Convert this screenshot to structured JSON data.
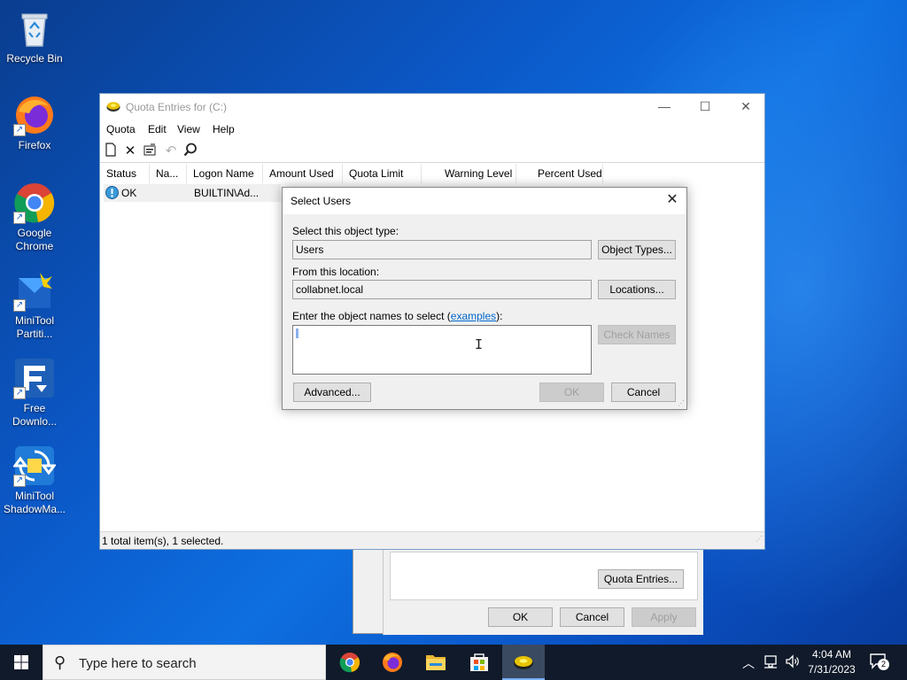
{
  "desktop": {
    "icons": [
      {
        "label": "Recycle Bin"
      },
      {
        "label": "Firefox"
      },
      {
        "label": "Google Chrome"
      },
      {
        "label": "MiniTool Partiti..."
      },
      {
        "label": "Free Downlo..."
      },
      {
        "label": "MiniTool ShadowMa..."
      }
    ]
  },
  "quota_window": {
    "title": "Quota Entries for  (C:)",
    "menu": [
      "Quota",
      "Edit",
      "View",
      "Help"
    ],
    "columns": [
      "Status",
      "Na...",
      "Logon Name",
      "Amount Used",
      "Quota Limit",
      "Warning Level",
      "Percent Used"
    ],
    "rows": [
      {
        "status": "OK",
        "name": "",
        "logon": "BUILTIN\\Ad..."
      }
    ],
    "status_bar": "1 total item(s), 1 selected."
  },
  "select_users": {
    "title": "Select Users",
    "object_type_label": "Select this object type:",
    "object_type_value": "Users",
    "object_types_button": "Object Types...",
    "location_label": "From this location:",
    "location_value": "collabnet.local",
    "locations_button": "Locations...",
    "names_label_pre": "Enter the object names to select (",
    "names_label_link": "examples",
    "names_label_post": "):",
    "check_names_button": "Check Names",
    "advanced_button": "Advanced...",
    "ok_button": "OK",
    "cancel_button": "Cancel"
  },
  "properties_dialog": {
    "quota_entries_button": "Quota Entries...",
    "ok_button": "OK",
    "cancel_button": "Cancel",
    "apply_button": "Apply"
  },
  "taskbar": {
    "search_placeholder": "Type here to search",
    "time": "4:04 AM",
    "date": "7/31/2023",
    "notification_count": "2",
    "apps": [
      "chrome-icon",
      "firefox-icon",
      "file-explorer-icon",
      "store-icon",
      "quota-app-icon"
    ]
  }
}
